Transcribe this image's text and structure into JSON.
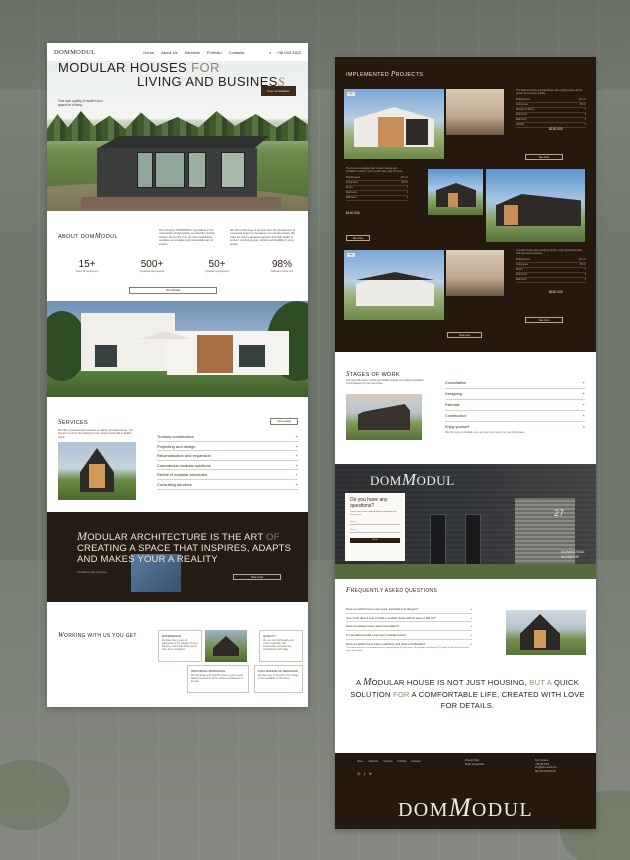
{
  "left": {
    "nav": {
      "logo": "DOMMODUL",
      "links": [
        "Home",
        "About Us",
        "Services",
        "Portfolio",
        "Contacts"
      ],
      "phone": "+38 093 3322"
    },
    "hero": {
      "title_line1_a": "MODULAR HOUSES",
      "title_line1_b": "FOR",
      "title_line2": "LIVING AND BUSINES",
      "title_line2_end": "S",
      "subtitle": "Your own quality of modern eco space for a living",
      "button": "Free consultation"
    },
    "about": {
      "title_a": "ABOUT DOM",
      "title_b": "M",
      "title_c": "ODUL",
      "text1": "The company \"DOMMODUL\" specializes in the construction of high-quality, eco-friendly modular houses. During this time, we have established ourselves as a reliable and responsible team of experts.",
      "text2": "We offer a full range of services from the development of a personal project to the delivery of a turnkey house. We value the client's personal approach and high quality of product, combining style, comfort and durability in every project.",
      "stats": [
        {
          "num": "15+",
          "label": "Years of experience"
        },
        {
          "num": "500+",
          "label": "Implemented projects"
        },
        {
          "num": "50+",
          "label": "Qualified employees"
        },
        {
          "num": "98%",
          "label": "Satisfied customers"
        }
      ],
      "button": "View Details"
    },
    "services": {
      "title_a": "S",
      "title_b": "ERVICES",
      "text": "We offer comprehensive services to realize your ideal house. You can turn to us for the drawing of your project and build a reliable home.",
      "button": "Get a quote",
      "items": [
        "Turnkey construction",
        "Projecting and design",
        "Reconstruction and expansion",
        "Commercial modular solutions",
        "Rental of modular structures",
        "Consulting services"
      ],
      "plus": "+"
    },
    "band": {
      "line_a": "M",
      "line_b": "ODULAR",
      "line_c": "ARCHITECTURE IS THE ART",
      "line_d": "OF",
      "line_e": "CREATING A SPACE THAT INSPIRES, ADAPTS AND MAKES YOUR",
      "line_f": "A REALITY",
      "small": "Something new every day",
      "button": "View more"
    },
    "working": {
      "title_a": "W",
      "title_b": "ORKING WITH US YOU GET",
      "cards": [
        {
          "title": "EXPERIENCE",
          "text": "We have many years of experience in the industry. During this time, more than 500 projects have been completed."
        },
        {
          "title": "QUALITY",
          "text": "We use only high-quality and proven materials. Our construction processes are controlled at each stage."
        },
        {
          "title": "INDIVIDUAL APPROACH",
          "text": "We will design and build the house to your needs, taking into account all the wishes and features of the site."
        },
        {
          "title": "FULL RANGE OF SERVICES",
          "text": "We take care of all works, from design to the installation of the house."
        }
      ]
    }
  },
  "right": {
    "projects": {
      "title_a": "IMPLEMENTED",
      "title_b": "P",
      "title_c": "ROJECTS",
      "tag": "Top",
      "blocks": [
        {
          "desc": "The black and white modular house with a large terrace will be perfect for a country holiday",
          "rows": [
            [
              "Building area",
              "120 m²"
            ],
            [
              "Living area",
              "95 m²"
            ],
            [
              "Number of floors",
              "1"
            ],
            [
              "Bedrooms",
              "2"
            ],
            [
              "Bathroom",
              "2"
            ],
            [
              "Parking",
              "1"
            ]
          ],
          "price": "$130 000",
          "button": "See more"
        },
        {
          "desc": "The house is equipped with modern heating and ventilation systems, and it is also fully ready for living.",
          "rows": [
            [
              "Building area",
              "120 m²"
            ],
            [
              "Living area",
              "95 m²"
            ],
            [
              "Floors",
              "1"
            ],
            [
              "Bedrooms",
              "2"
            ],
            [
              "Bathroom",
              "2"
            ]
          ],
          "price": "$140 000",
          "button": "See more"
        },
        {
          "desc": "A modern house that combines comfort, style and functionality with panoramic windows.",
          "rows": [
            [
              "Building area",
              "120 m²"
            ],
            [
              "Living area",
              "95 m²"
            ],
            [
              "Floors",
              "1"
            ],
            [
              "Bedrooms",
              "2"
            ],
            [
              "Bathroom",
              "2"
            ]
          ],
          "price": "$180 000",
          "button": "See more"
        }
      ],
      "view_all": "View more"
    },
    "stages": {
      "title_a": "S",
      "title_b": "TAGES OF WORK",
      "text": "Our team will ensure a quick and reliable process, from initial consultation to the handover of your new home.",
      "items": [
        "Consultation",
        "Designing",
        "Estimate",
        "Construction",
        "Enjoy yourself"
      ],
      "desc": "After the house is complete, you can move in and enjoy your new living space.",
      "plus": "+",
      "x": "×"
    },
    "question": {
      "logo_a": "DOM",
      "logo_b": "M",
      "logo_c": "ODUL",
      "form_title": "Do you have any questions?",
      "form_sub": "Leave your contact details and our manager will contact you",
      "field_name": "Name",
      "field_phone": "Phone",
      "send": "Send",
      "house_number": "27",
      "site_line1": "DOMMODUL",
      "site_line2": "MODERN"
    },
    "faq": {
      "title_a": "F",
      "title_b": "REQUENTLY ASKED QUESTIONS",
      "items": [
        "Does a modular home cost a plot, and what is its lifespan?",
        "How much does it cost to build a modular house with an area of 100 m²?",
        "Does a modular house need a foundation?",
        "Is it possible to build a two-story modular house?",
        "Does a modular home have a warranty, and what is its lifespan?"
      ],
      "answer": "The frame structure of a modular house is designed for 50-100 years. We provide a warranty of 10 years for the structure and 2 years for finishes.",
      "plus": "+",
      "x": "×"
    },
    "quote": {
      "a": "A",
      "b": "M",
      "c": "ODULAR HOUSE IS NOT JUST HOUSING,",
      "d": "BUT A",
      "e": "QUICK SOLUTION",
      "f": "FOR",
      "g": "A COMFORTABLE LIFE, CREATED WITH LOVE FOR DETAILS."
    },
    "footer": {
      "links": [
        "Home",
        "About Us",
        "Services",
        "Portfolio",
        "Contacts"
      ],
      "col2": [
        "Privacy Policy",
        "Public Cooperation"
      ],
      "col3": [
        "Kyiv, Ukraine",
        "+38 093 3322",
        "info@dommodul.com",
        "Mon-Fri 09:00-18:00"
      ],
      "logo_a": "DOM",
      "logo_b": "M",
      "logo_c": "ODUL"
    }
  }
}
